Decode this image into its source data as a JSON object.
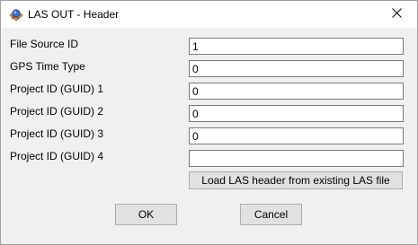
{
  "window": {
    "title": "LAS OUT - Header"
  },
  "form": {
    "fields": [
      {
        "label": "File Source ID",
        "value": "1"
      },
      {
        "label": "GPS Time Type",
        "value": "0"
      },
      {
        "label": "Project ID (GUID) 1",
        "value": "0"
      },
      {
        "label": "Project ID (GUID) 2",
        "value": "0"
      },
      {
        "label": "Project ID (GUID) 3",
        "value": "0"
      },
      {
        "label": "Project ID (GUID) 4",
        "value": ""
      }
    ],
    "load_button_label": "Load LAS header from existing LAS file"
  },
  "buttons": {
    "ok_label": "OK",
    "cancel_label": "Cancel"
  },
  "icons": {
    "app": "las-app-icon",
    "close": "close-icon"
  }
}
